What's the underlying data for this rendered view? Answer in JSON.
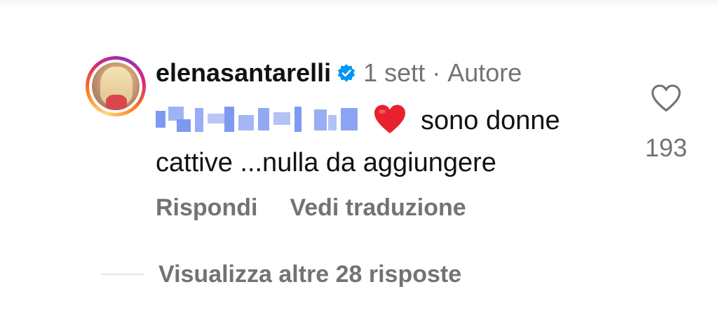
{
  "comment": {
    "username": "elenasantarelli",
    "time_ago": "1 sett",
    "separator": "·",
    "author_label": "Autore",
    "text_line1": "sono donne",
    "text_line2": "cattive ...nulla da aggiungere",
    "like_count": "193"
  },
  "actions": {
    "reply_label": "Rispondi",
    "translate_label": "Vedi traduzione"
  },
  "replies": {
    "view_more_label": "Visualizza altre 28 risposte"
  },
  "icons": {
    "avatar": "profile-avatar",
    "verified": "verified-badge-icon",
    "emoji": "red-heart-emoji",
    "like": "heart-outline-icon"
  },
  "colors": {
    "text": "#111111",
    "secondary": "#737373",
    "verified_blue": "#0095f6",
    "mention_blur": "#7e99f0",
    "heart_red": "#e8212e"
  }
}
